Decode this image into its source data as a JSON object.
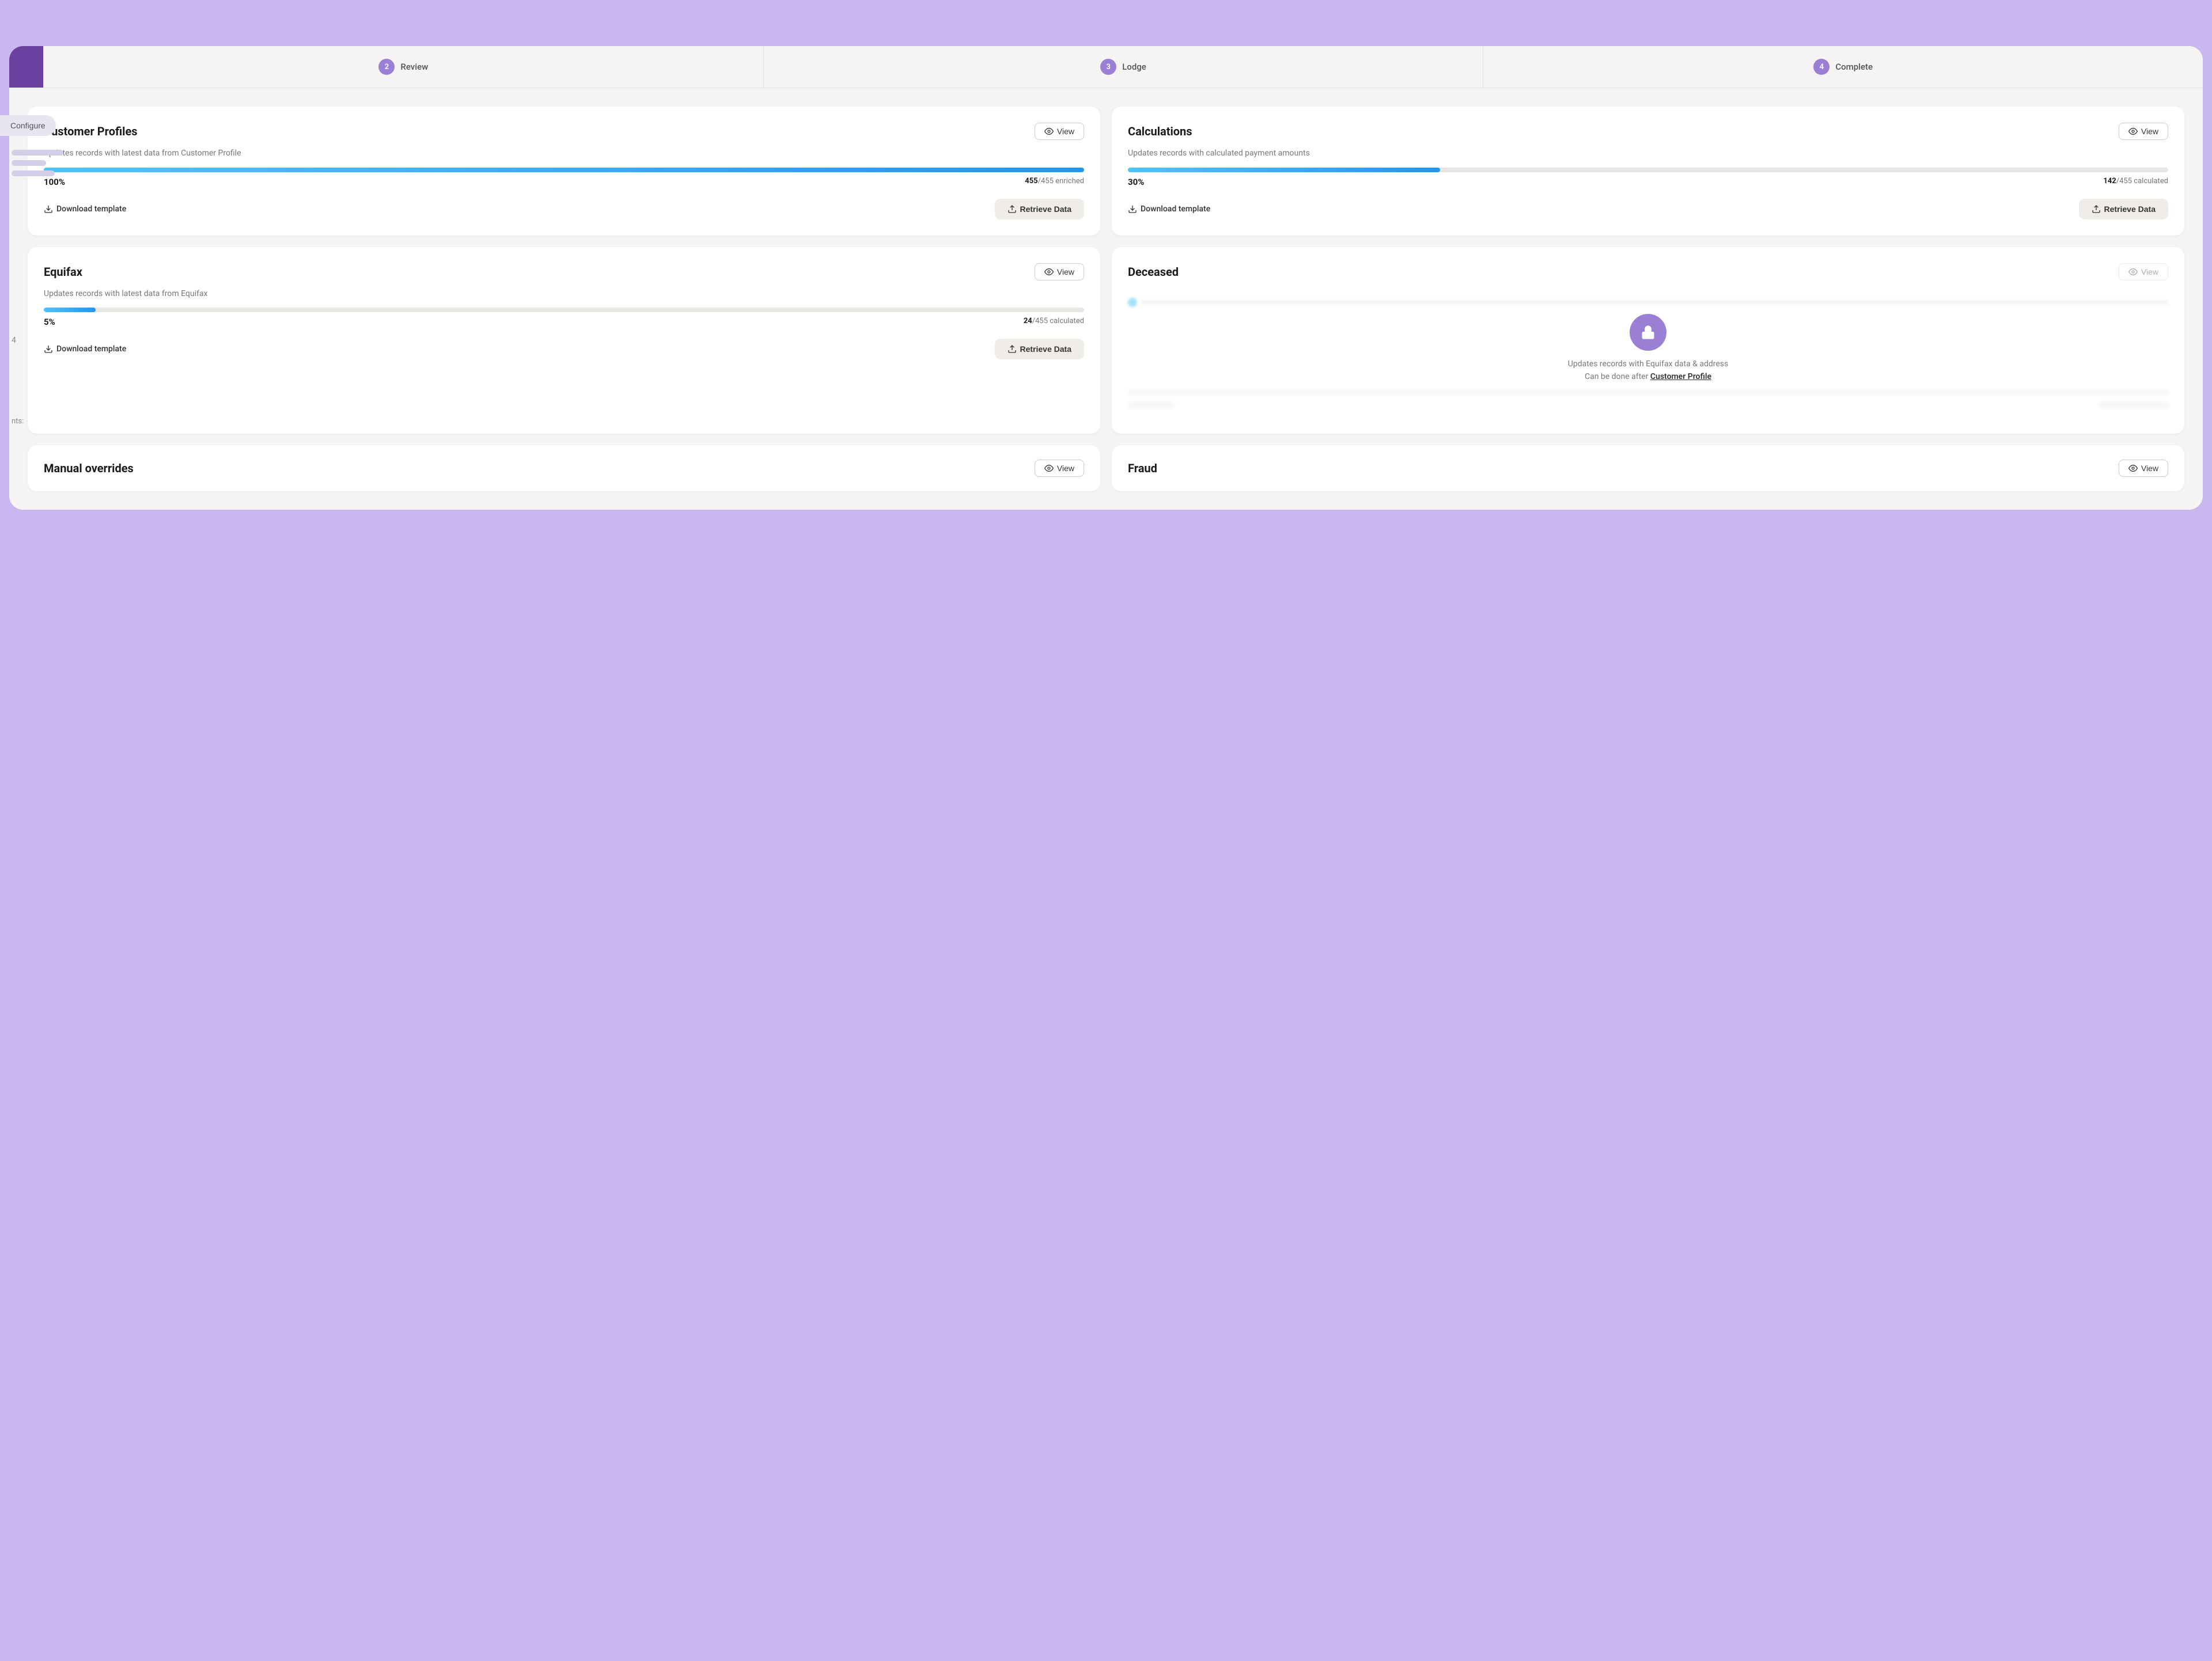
{
  "steps": [
    {
      "id": "step-1",
      "number": "",
      "label": "",
      "active": true
    },
    {
      "id": "step-2",
      "number": "2",
      "label": "Review",
      "active": false
    },
    {
      "id": "step-3",
      "number": "3",
      "label": "Lodge",
      "active": false
    },
    {
      "id": "step-4",
      "number": "4",
      "label": "Complete",
      "active": false
    }
  ],
  "sidebar": {
    "configure_label": "Configure",
    "stubs": [
      90,
      60,
      70
    ]
  },
  "cards": [
    {
      "id": "customer-profiles",
      "title": "Customer Profiles",
      "description": "Updates records with latest data from Customer Profile",
      "progress_pct": 100,
      "progress_label": "100%",
      "progress_count": "455",
      "progress_total": "455",
      "progress_unit": "enriched",
      "progress_fill_class": "full",
      "view_label": "View",
      "view_disabled": false,
      "download_label": "Download template",
      "retrieve_label": "Retrieve Data",
      "locked": false
    },
    {
      "id": "calculations",
      "title": "Calculations",
      "description": "Updates records with calculated payment amounts",
      "progress_pct": 30,
      "progress_label": "30%",
      "progress_count": "142",
      "progress_total": "455",
      "progress_unit": "calculated",
      "progress_fill_class": "calc",
      "view_label": "View",
      "view_disabled": false,
      "download_label": "Download template",
      "retrieve_label": "Retrieve Data",
      "locked": false
    },
    {
      "id": "equifax",
      "title": "Equifax",
      "description": "Updates records with latest data from Equifax",
      "progress_pct": 5,
      "progress_label": "5%",
      "progress_count": "24",
      "progress_total": "455",
      "progress_unit": "calculated",
      "progress_fill_class": "eq",
      "view_label": "View",
      "view_disabled": false,
      "download_label": "Download template",
      "retrieve_label": "Retrieve Data",
      "locked": false
    },
    {
      "id": "deceased",
      "title": "Deceased",
      "description": "",
      "locked": true,
      "lock_text_line1": "Updates records with Equifax data & address",
      "lock_text_line2": "Can be done after",
      "lock_link_text": "Customer Profile",
      "view_label": "View",
      "view_disabled": true
    }
  ],
  "partial_cards": [
    {
      "id": "manual-overrides",
      "title": "Manual overrides",
      "view_label": "View",
      "view_disabled": false
    },
    {
      "id": "fraud",
      "title": "Fraud",
      "view_label": "View",
      "view_disabled": false
    }
  ],
  "icons": {
    "eye": "👁",
    "download": "⬇",
    "upload": "⬆",
    "lock": "🔒"
  }
}
